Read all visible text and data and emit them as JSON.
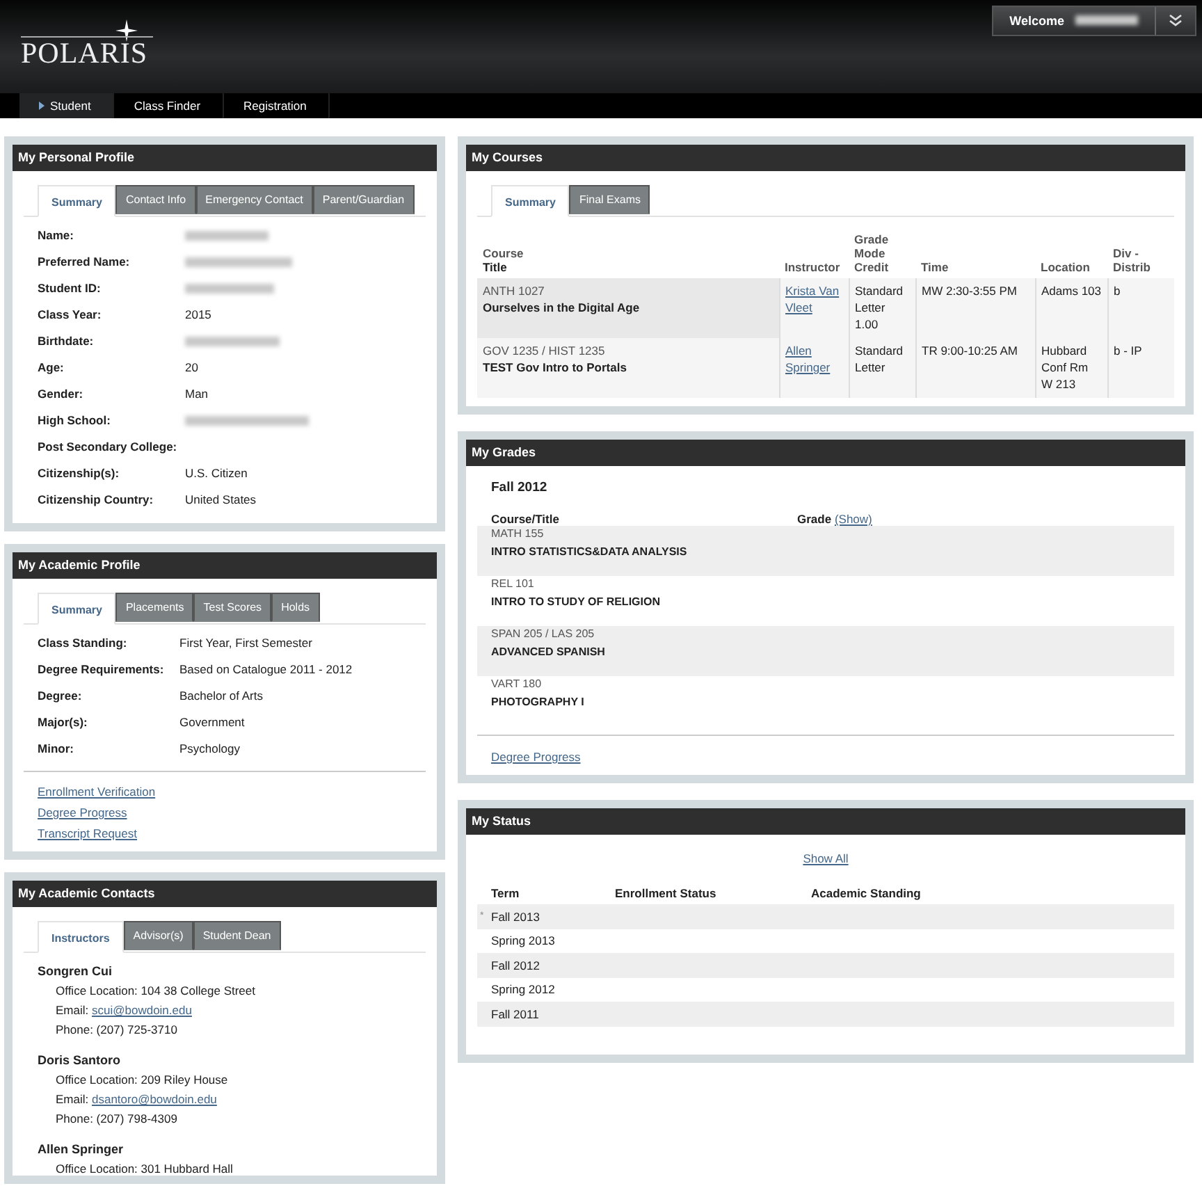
{
  "header": {
    "logo": "POLARIS",
    "welcome": "Welcome"
  },
  "nav": [
    {
      "label": "Student",
      "selected": true
    },
    {
      "label": "Class Finder",
      "selected": false
    },
    {
      "label": "Registration",
      "selected": false
    }
  ],
  "personal_profile": {
    "title": "My Personal Profile",
    "tabs": [
      {
        "label": "Summary",
        "selected": true
      },
      {
        "label": "Contact Info",
        "selected": false
      },
      {
        "label": "Emergency Contact",
        "selected": false
      },
      {
        "label": "Parent/Guardian",
        "selected": false
      }
    ],
    "fields": [
      {
        "label": "Name:",
        "kind": "redacted"
      },
      {
        "label": "Preferred Name:",
        "kind": "redacted"
      },
      {
        "label": "Student ID:",
        "kind": "redacted"
      },
      {
        "label": "Class Year:",
        "kind": "text",
        "value": "2015"
      },
      {
        "label": "Birthdate:",
        "kind": "redacted"
      },
      {
        "label": "Age:",
        "kind": "text",
        "value": "20"
      },
      {
        "label": "Gender:",
        "kind": "text",
        "value": "Man"
      },
      {
        "label": "High School:",
        "kind": "redacted"
      },
      {
        "label": "Post Secondary College:",
        "kind": "empty"
      },
      {
        "label": "Citizenship(s):",
        "kind": "text",
        "value": "U.S. Citizen"
      },
      {
        "label": "Citizenship Country:",
        "kind": "text",
        "value": "United States"
      }
    ]
  },
  "academic_profile": {
    "title": "My Academic Profile",
    "tabs": [
      {
        "label": "Summary",
        "selected": true
      },
      {
        "label": "Placements",
        "selected": false
      },
      {
        "label": "Test Scores",
        "selected": false
      },
      {
        "label": "Holds",
        "selected": false
      }
    ],
    "fields": [
      {
        "label": "Class Standing:",
        "value": "First Year, First Semester"
      },
      {
        "label": "Degree Requirements:",
        "value": "Based on Catalogue 2011 - 2012"
      },
      {
        "label": "Degree:",
        "value": "Bachelor of Arts"
      },
      {
        "label": "Major(s):",
        "value": "Government"
      },
      {
        "label": "Minor:",
        "value": "Psychology"
      }
    ],
    "links": [
      "Enrollment Verification",
      "Degree Progress",
      "Transcript Request"
    ]
  },
  "academic_contacts": {
    "title": "My Academic Contacts",
    "tabs": [
      {
        "label": "Instructors",
        "selected": true
      },
      {
        "label": "Advisor(s)",
        "selected": false
      },
      {
        "label": "Student Dean",
        "selected": false
      }
    ],
    "contacts": [
      {
        "name": "Songren Cui",
        "office": "Office Location: 104 38 College Street",
        "email_prefix": "Email:",
        "email": "scui@bowdoin.edu",
        "phone": "Phone: (207) 725-3710"
      },
      {
        "name": "Doris Santoro",
        "office": "Office Location: 209 Riley House",
        "email_prefix": "Email:",
        "email": "dsantoro@bowdoin.edu",
        "phone": "Phone: (207) 798-4309"
      },
      {
        "name": "Allen Springer",
        "office": "Office Location: 301 Hubbard Hall"
      }
    ]
  },
  "courses": {
    "title": "My Courses",
    "tabs": [
      {
        "label": "Summary",
        "selected": true
      },
      {
        "label": "Final Exams",
        "selected": false
      }
    ],
    "columns": [
      {
        "label": "Course",
        "sublabel": "Title"
      },
      {
        "label": "Instructor"
      },
      {
        "label": "Grade Mode Credit"
      },
      {
        "label": "Time"
      },
      {
        "label": "Location"
      },
      {
        "label": "Div - Distrib"
      }
    ],
    "rows": [
      {
        "code": "ANTH 1027",
        "title": "Ourselves in the Digital Age",
        "instructor": "Krista Van Vleet",
        "grade_mode": "Standard Letter 1.00",
        "time": "MW 2:30-3:55 PM",
        "location": "Adams 103",
        "distrib": "b",
        "selected": true
      },
      {
        "code": "GOV 1235 / HIST 1235",
        "title": "TEST Gov Intro to Portals",
        "instructor": "Allen Springer",
        "grade_mode": "Standard Letter",
        "time": "TR 9:00-10:25 AM",
        "location": "Hubbard Conf Rm W 213",
        "distrib": "b - IP",
        "selected": false
      }
    ]
  },
  "grades": {
    "title": "My Grades",
    "term": "Fall 2012",
    "course_column": "Course/Title",
    "grade_column": "Grade",
    "show_link": "(Show)",
    "rows": [
      {
        "code": "MATH 155",
        "title": "INTRO STATISTICS&DATA ANALYSIS"
      },
      {
        "code": "REL 101",
        "title": "INTRO TO STUDY OF RELIGION"
      },
      {
        "code": "SPAN 205 / LAS 205",
        "title": "ADVANCED SPANISH"
      },
      {
        "code": "VART 180",
        "title": "PHOTOGRAPHY I"
      }
    ],
    "link": "Degree Progress"
  },
  "status": {
    "title": "My Status",
    "show_all": "Show All",
    "columns": [
      "Term",
      "Enrollment Status",
      "Academic Standing"
    ],
    "rows": [
      {
        "marker": "*",
        "term": "Fall 2013"
      },
      {
        "term": "Spring 2013"
      },
      {
        "term": "Fall 2012"
      },
      {
        "term": "Spring 2012"
      },
      {
        "term": "Fall 2011"
      }
    ]
  }
}
